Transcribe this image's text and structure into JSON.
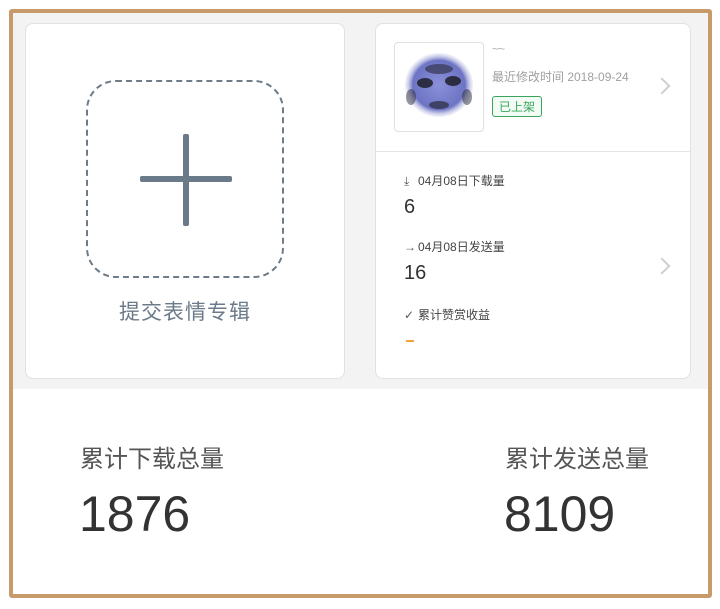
{
  "submit_card": {
    "label": "提交表情专辑"
  },
  "album": {
    "name": "~~",
    "modified": "最近修改时间 2018-09-24",
    "status": "已上架",
    "download_label": "04月08日下载量",
    "download_value": "6",
    "send_label": "04月08日发送量",
    "send_value": "16",
    "reward_label": "累计赞赏收益",
    "reward_value": "-",
    "icons": {
      "download": "download-arrow-icon",
      "send": "right-arrow-icon",
      "reward": "check-icon",
      "chevron": "chevron-right-icon"
    }
  },
  "totals": {
    "download_label": "累计下载总量",
    "download_value": "1876",
    "send_label": "累计发送总量",
    "send_value": "8109"
  },
  "colors": {
    "frame": "#c79a6a",
    "accent_green": "#3aa55a",
    "dash_orange": "#f0a33a",
    "plus_gray": "#6b7a88"
  }
}
